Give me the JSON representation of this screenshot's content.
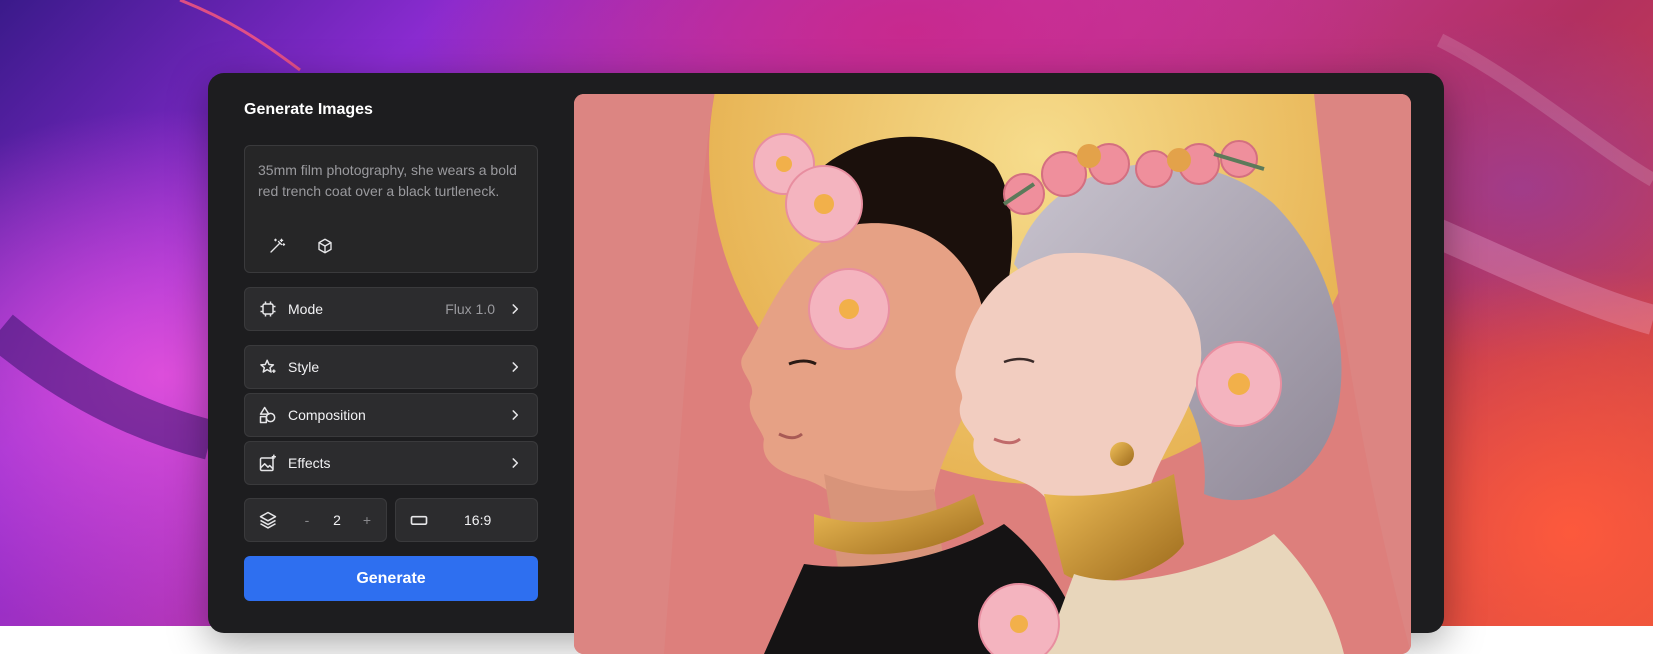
{
  "panel": {
    "title": "Generate Images",
    "prompt": {
      "text": "35mm film photography, she wears a bold red trench coat over a black turtleneck."
    },
    "tools": [
      {
        "icon": "magic-wand-icon"
      },
      {
        "icon": "cube-icon"
      }
    ],
    "settings": [
      {
        "label": "Mode",
        "value": "Flux 1.0",
        "icon": "chip-icon"
      },
      {
        "label": "Style",
        "icon": "sparkle-star-icon"
      },
      {
        "label": "Composition",
        "icon": "shapes-icon"
      },
      {
        "label": "Effects",
        "icon": "image-sparkle-icon"
      }
    ],
    "count": {
      "icon": "layers-icon",
      "minus": "-",
      "value": "2",
      "plus": "+"
    },
    "aspect_ratio": {
      "icon": "rectangle-icon",
      "value": "16:9"
    },
    "generate_label": "Generate"
  },
  "colors": {
    "panel_bg": "#1d1d1f",
    "row_bg": "#2c2c2e",
    "accent": "#2e6ff0"
  }
}
